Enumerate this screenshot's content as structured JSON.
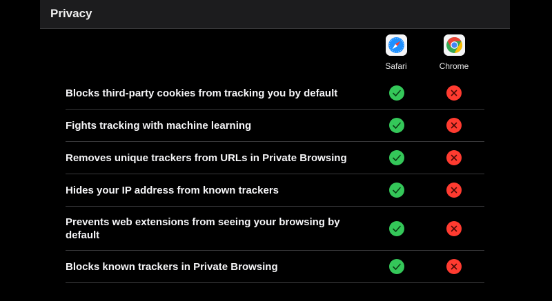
{
  "header": {
    "title": "Privacy"
  },
  "browsers": [
    {
      "name": "Safari",
      "icon": "safari-compass-icon"
    },
    {
      "name": "Chrome",
      "icon": "chrome-logo-icon"
    }
  ],
  "colors": {
    "yes": "#34c759",
    "no": "#ff3b30",
    "background": "#000000"
  },
  "features": [
    {
      "label": "Blocks third-party cookies from tracking you by default",
      "safari": "check-icon",
      "chrome": "x-icon"
    },
    {
      "label": "Fights tracking with machine learning",
      "safari": "check-icon",
      "chrome": "x-icon"
    },
    {
      "label": "Removes unique trackers from URLs in Private Browsing",
      "safari": "check-icon",
      "chrome": "x-icon"
    },
    {
      "label": "Hides your IP address from known trackers",
      "safari": "check-icon",
      "chrome": "x-icon"
    },
    {
      "label": "Prevents web extensions from seeing your browsing by default",
      "safari": "check-icon",
      "chrome": "x-icon"
    },
    {
      "label": "Blocks known trackers in Private Browsing",
      "safari": "check-icon",
      "chrome": "x-icon"
    }
  ]
}
